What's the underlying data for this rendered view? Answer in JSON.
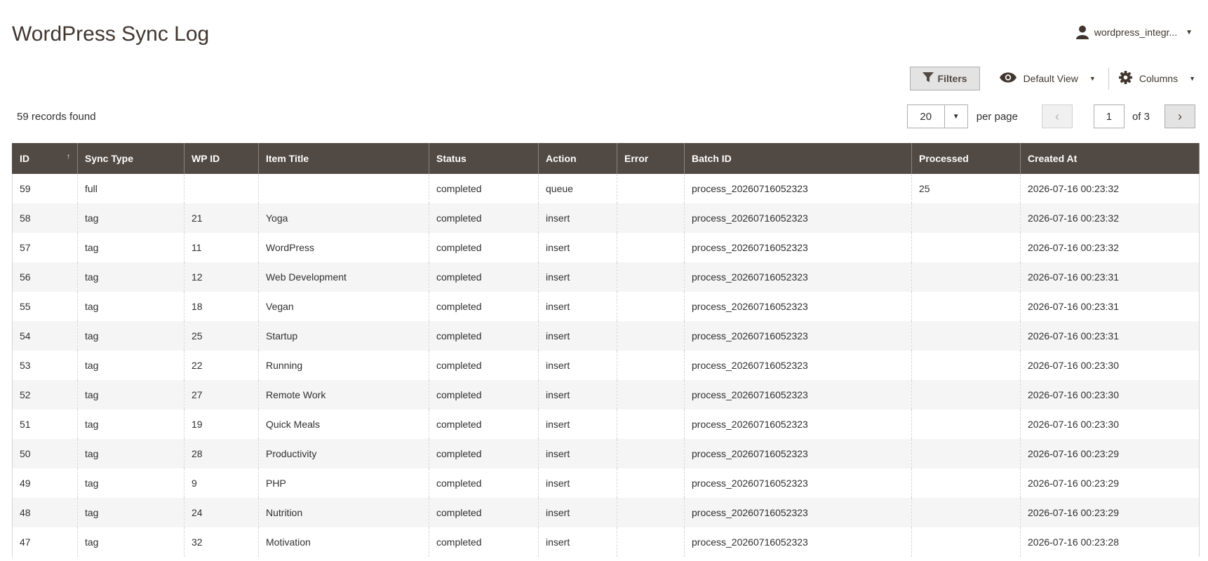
{
  "page": {
    "title": "WordPress Sync Log"
  },
  "account": {
    "username": "wordpress_integr...",
    "icon": "user-icon"
  },
  "toolbar": {
    "filters_label": "Filters",
    "view_label": "Default View",
    "columns_label": "Columns"
  },
  "records_found": "59 records found",
  "pager": {
    "per_page_value": "20",
    "per_page_label": "per page",
    "current_page": "1",
    "of_label": "of 3"
  },
  "columns": [
    "ID",
    "Sync Type",
    "WP ID",
    "Item Title",
    "Status",
    "Action",
    "Error",
    "Batch ID",
    "Processed",
    "Created At"
  ],
  "rows": [
    {
      "id": "59",
      "sync_type": "full",
      "wp_id": "",
      "title": "",
      "status": "completed",
      "action": "queue",
      "error": "",
      "batch_id": "process_20260716052323",
      "processed": "25",
      "created_at": "2026-07-16 00:23:32"
    },
    {
      "id": "58",
      "sync_type": "tag",
      "wp_id": "21",
      "title": "Yoga",
      "status": "completed",
      "action": "insert",
      "error": "",
      "batch_id": "process_20260716052323",
      "processed": "",
      "created_at": "2026-07-16 00:23:32"
    },
    {
      "id": "57",
      "sync_type": "tag",
      "wp_id": "11",
      "title": "WordPress",
      "status": "completed",
      "action": "insert",
      "error": "",
      "batch_id": "process_20260716052323",
      "processed": "",
      "created_at": "2026-07-16 00:23:32"
    },
    {
      "id": "56",
      "sync_type": "tag",
      "wp_id": "12",
      "title": "Web Development",
      "status": "completed",
      "action": "insert",
      "error": "",
      "batch_id": "process_20260716052323",
      "processed": "",
      "created_at": "2026-07-16 00:23:31"
    },
    {
      "id": "55",
      "sync_type": "tag",
      "wp_id": "18",
      "title": "Vegan",
      "status": "completed",
      "action": "insert",
      "error": "",
      "batch_id": "process_20260716052323",
      "processed": "",
      "created_at": "2026-07-16 00:23:31"
    },
    {
      "id": "54",
      "sync_type": "tag",
      "wp_id": "25",
      "title": "Startup",
      "status": "completed",
      "action": "insert",
      "error": "",
      "batch_id": "process_20260716052323",
      "processed": "",
      "created_at": "2026-07-16 00:23:31"
    },
    {
      "id": "53",
      "sync_type": "tag",
      "wp_id": "22",
      "title": "Running",
      "status": "completed",
      "action": "insert",
      "error": "",
      "batch_id": "process_20260716052323",
      "processed": "",
      "created_at": "2026-07-16 00:23:30"
    },
    {
      "id": "52",
      "sync_type": "tag",
      "wp_id": "27",
      "title": "Remote Work",
      "status": "completed",
      "action": "insert",
      "error": "",
      "batch_id": "process_20260716052323",
      "processed": "",
      "created_at": "2026-07-16 00:23:30"
    },
    {
      "id": "51",
      "sync_type": "tag",
      "wp_id": "19",
      "title": "Quick Meals",
      "status": "completed",
      "action": "insert",
      "error": "",
      "batch_id": "process_20260716052323",
      "processed": "",
      "created_at": "2026-07-16 00:23:30"
    },
    {
      "id": "50",
      "sync_type": "tag",
      "wp_id": "28",
      "title": "Productivity",
      "status": "completed",
      "action": "insert",
      "error": "",
      "batch_id": "process_20260716052323",
      "processed": "",
      "created_at": "2026-07-16 00:23:29"
    },
    {
      "id": "49",
      "sync_type": "tag",
      "wp_id": "9",
      "title": "PHP",
      "status": "completed",
      "action": "insert",
      "error": "",
      "batch_id": "process_20260716052323",
      "processed": "",
      "created_at": "2026-07-16 00:23:29"
    },
    {
      "id": "48",
      "sync_type": "tag",
      "wp_id": "24",
      "title": "Nutrition",
      "status": "completed",
      "action": "insert",
      "error": "",
      "batch_id": "process_20260716052323",
      "processed": "",
      "created_at": "2026-07-16 00:23:29"
    },
    {
      "id": "47",
      "sync_type": "tag",
      "wp_id": "32",
      "title": "Motivation",
      "status": "completed",
      "action": "insert",
      "error": "",
      "batch_id": "process_20260716052323",
      "processed": "",
      "created_at": "2026-07-16 00:23:28"
    }
  ],
  "colors": {
    "header_bg": "#514943",
    "title_text": "#41362f",
    "row_alt_bg": "#f5f5f5",
    "button_bg": "#e3e3e3"
  }
}
